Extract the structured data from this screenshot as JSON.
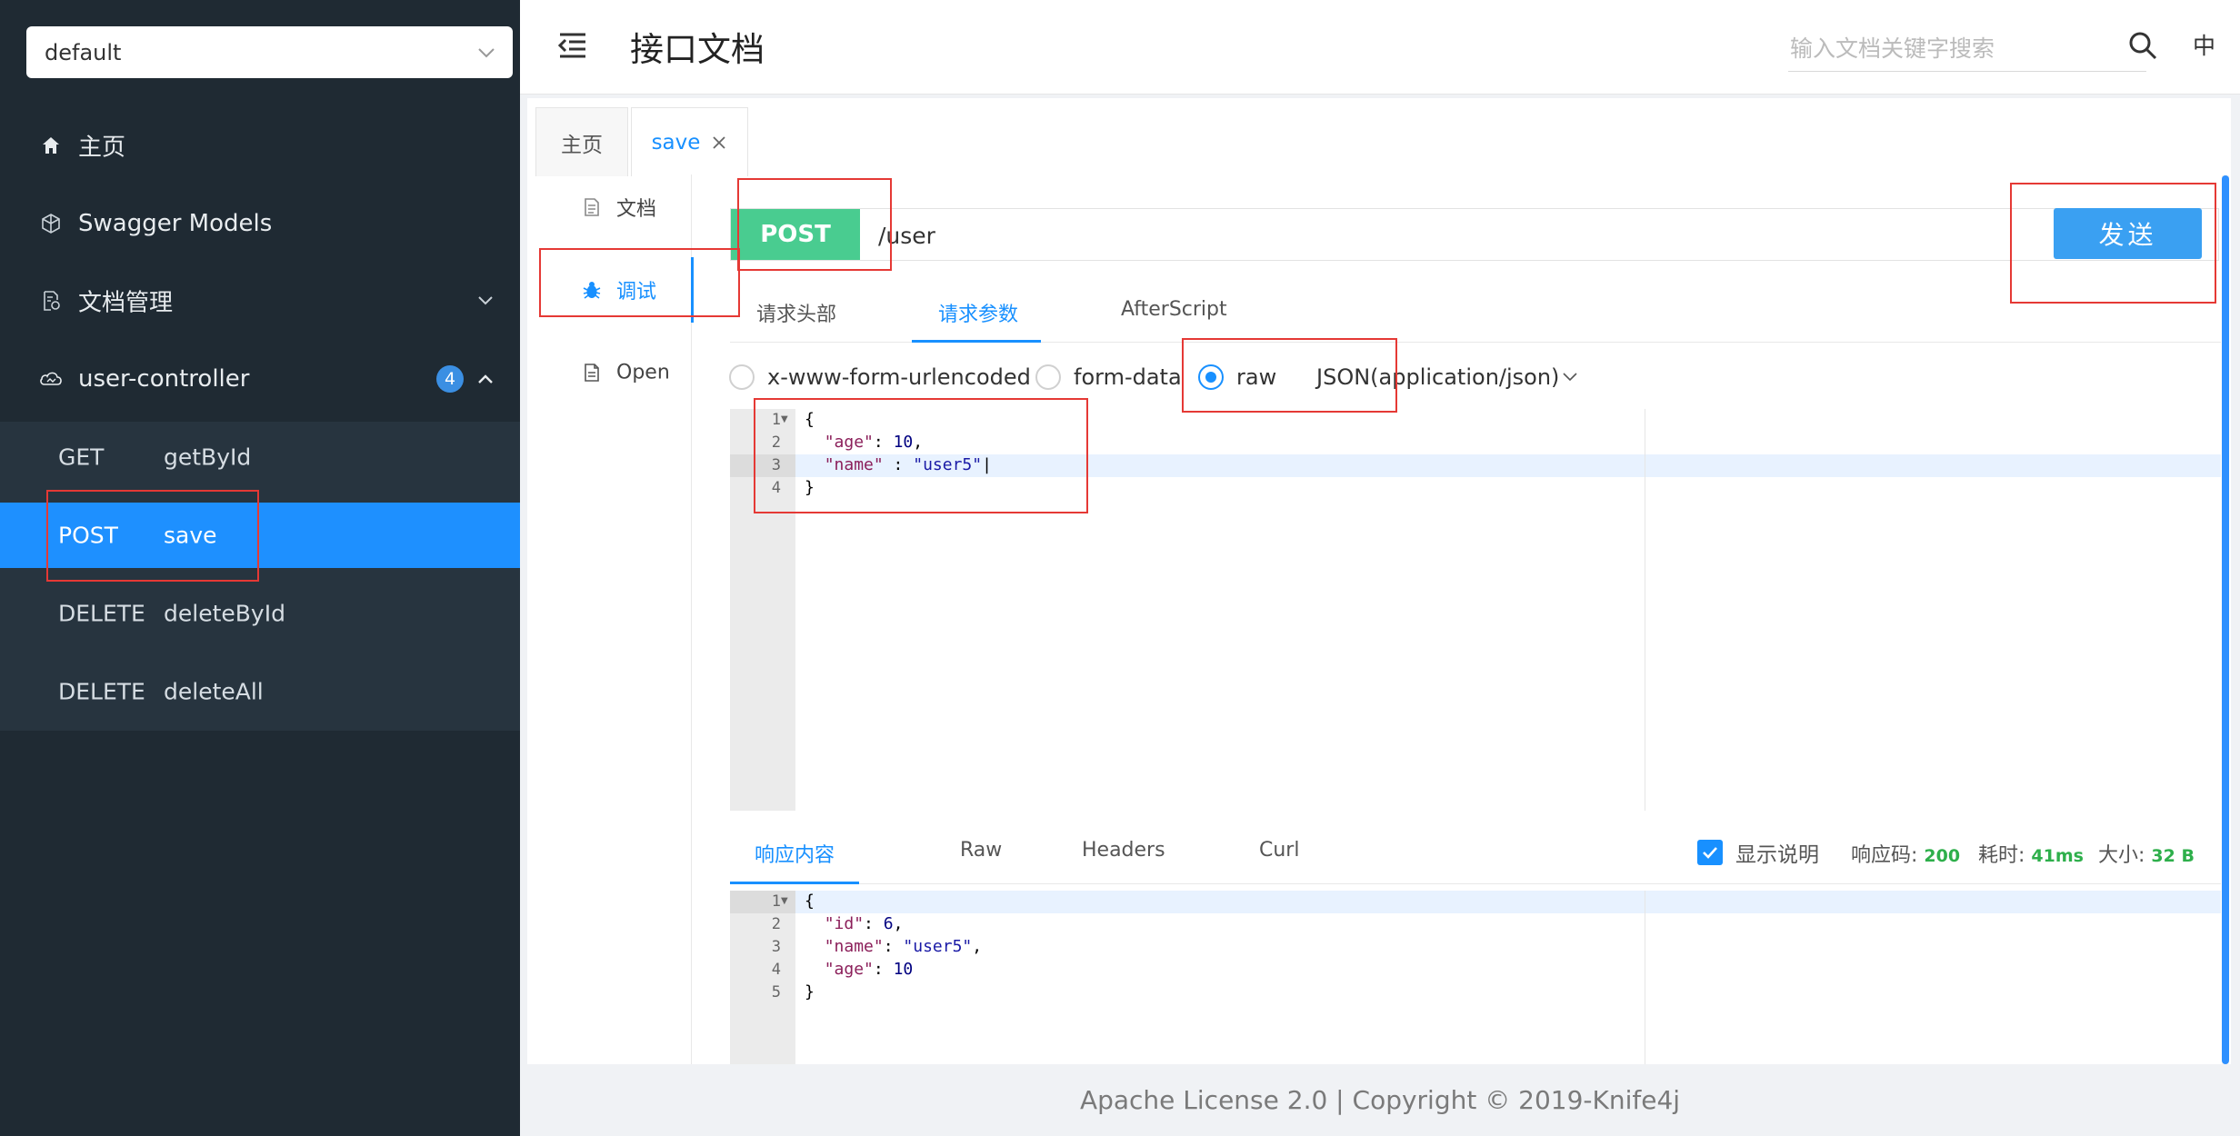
{
  "sidebar": {
    "group_select": "default",
    "nav": {
      "home": "主页",
      "models": "Swagger Models",
      "docs": "文档管理",
      "controller": "user-controller",
      "controller_count": "4"
    },
    "apis": [
      {
        "method": "GET",
        "name": "getById"
      },
      {
        "method": "POST",
        "name": "save"
      },
      {
        "method": "DELETE",
        "name": "deleteById"
      },
      {
        "method": "DELETE",
        "name": "deleteAll"
      }
    ],
    "active_api": "save"
  },
  "header": {
    "title": "接口文档",
    "search_placeholder": "输入文档关键字搜索",
    "lang": "中"
  },
  "tabs": [
    {
      "label": "主页",
      "active": false
    },
    {
      "label": "save",
      "active": true,
      "closable": true
    }
  ],
  "doc_side": {
    "doc": "文档",
    "debug": "调试",
    "open": "Open",
    "active": "调试"
  },
  "request": {
    "method": "POST",
    "url": "/user",
    "send_label": "发送",
    "subtabs": [
      "请求头部",
      "请求参数",
      "AfterScript"
    ],
    "active_subtab": "请求参数",
    "body_types": [
      "x-www-form-urlencoded",
      "form-data",
      "raw"
    ],
    "selected_body_type": "raw",
    "content_type": "JSON(application/json)",
    "body_lines": [
      "{",
      "  \"age\": 10,",
      "  \"name\" : \"user5\"",
      "}"
    ]
  },
  "response": {
    "tabs": [
      "响应内容",
      "Raw",
      "Headers",
      "Curl"
    ],
    "active_tab": "响应内容",
    "show_desc_label": "显示说明",
    "show_desc_checked": true,
    "code_label": "响应码:",
    "code": "200",
    "time_label": "耗时:",
    "time": "41ms",
    "size_label": "大小:",
    "size": "32 B",
    "body_lines": [
      "{",
      "  \"id\": 6,",
      "  \"name\": \"user5\",",
      "  \"age\": 10",
      "}"
    ]
  },
  "footer": "Apache License 2.0 | Copyright © 2019-Knife4j",
  "colors": {
    "sidebar_bg": "#1f2a33",
    "active_blue": "#1e90ff",
    "post_green": "#49cc90",
    "send_blue": "#3aa0f2",
    "annotation_red": "#e53935",
    "stat_green": "#2eaf4b"
  }
}
